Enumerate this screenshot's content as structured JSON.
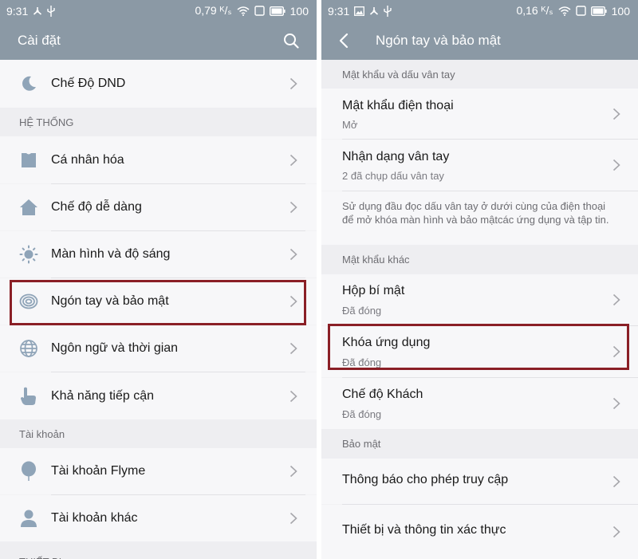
{
  "left_screen": {
    "status": {
      "time": "9:31",
      "data_speed": "0,79 ᴷ/ₛ",
      "battery": "100"
    },
    "header": {
      "title": "Cài đặt"
    },
    "dnd_label": "Chế Độ DND",
    "section_system": "HỆ THỐNG",
    "system_items": [
      {
        "label": "Cá nhân hóa",
        "icon": "shirt-icon"
      },
      {
        "label": "Chế độ dễ dàng",
        "icon": "home-icon"
      },
      {
        "label": "Màn hình và độ sáng",
        "icon": "brightness-icon"
      },
      {
        "label": "Ngón tay và bảo mật",
        "icon": "fingerprint-icon"
      },
      {
        "label": "Ngôn ngữ và thời gian",
        "icon": "globe-icon"
      },
      {
        "label": "Khả năng tiếp cận",
        "icon": "hand-pointer-icon"
      }
    ],
    "section_account": "Tài khoản",
    "account_items": [
      {
        "label": "Tài khoản Flyme",
        "icon": "balloon-icon"
      },
      {
        "label": "Tài khoản khác",
        "icon": "person-icon"
      }
    ],
    "section_device": "THIẾT BỊ"
  },
  "right_screen": {
    "status": {
      "time": "9:31",
      "data_speed": "0,16 ᴷ/ₛ",
      "battery": "100"
    },
    "header": {
      "title": "Ngón tay và bảo mật"
    },
    "section_password_fp": "Mật khẩu và dấu vân tay",
    "phone_password": {
      "title": "Mật khẩu điện thoại",
      "subtitle": "Mở"
    },
    "fingerprint": {
      "title": "Nhận dạng vân tay",
      "subtitle": "2 đã chụp dấu vân tay"
    },
    "fingerprint_note": "Sử dụng đầu đọc dấu vân tay ở dưới cùng của điện thoại để mở khóa màn hình và bảo mậtcác ứng dụng và tập tin.",
    "section_other_password": "Mật khẩu khác",
    "secret_box": {
      "title": "Hộp bí mật",
      "subtitle": "Đã đóng"
    },
    "app_lock": {
      "title": "Khóa ứng dụng",
      "subtitle": "Đã đóng"
    },
    "guest_mode": {
      "title": "Chế độ Khách",
      "subtitle": "Đã đóng"
    },
    "section_security": "Bảo mật",
    "security_items": [
      {
        "title": "Thông báo cho phép truy cập"
      },
      {
        "title": "Thiết bị và thông tin xác thực"
      }
    ]
  },
  "colors": {
    "appbar": "#8b99a5",
    "icon": "#8fa4b8",
    "highlight": "#8a1f26",
    "background": "#f2f2f4"
  }
}
